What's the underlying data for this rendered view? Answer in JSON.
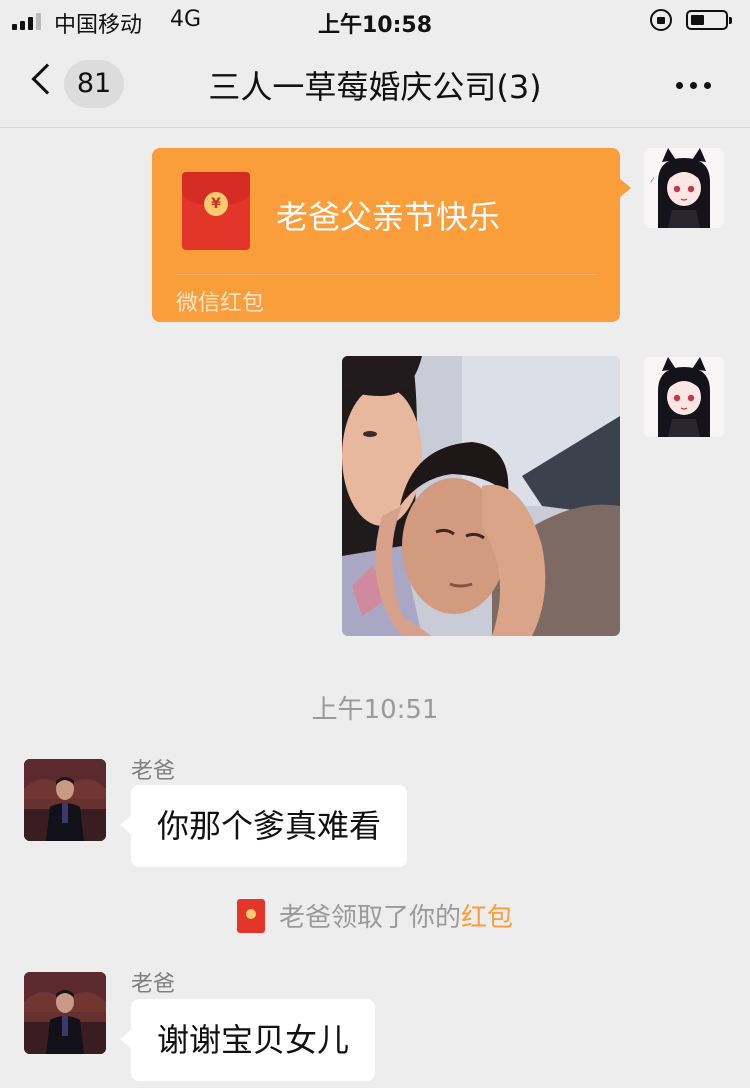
{
  "status_bar": {
    "carrier": "中国移动",
    "network": "4G",
    "time": "上午10:58"
  },
  "nav": {
    "unread_count": "81",
    "title": "三人一草莓婚庆公司(3)",
    "back_icon": "chevron-left-icon",
    "more_icon": "more-dots-icon"
  },
  "messages": {
    "red_packet": {
      "text": "老爸父亲节快乐",
      "footer": "微信红包",
      "icon": "red-envelope-icon",
      "color": "#fa9d3b"
    },
    "photo": {
      "icon": "photo-icon"
    },
    "timestamp": "上午10:51",
    "incoming_1": {
      "sender": "老爸",
      "text": "你那个爹真难看"
    },
    "system_notice": {
      "prefix": "老爸领取了你的",
      "link": "红包",
      "link_color": "#fa9d3b"
    },
    "incoming_2": {
      "sender": "老爸",
      "text": "谢谢宝贝女儿"
    }
  }
}
